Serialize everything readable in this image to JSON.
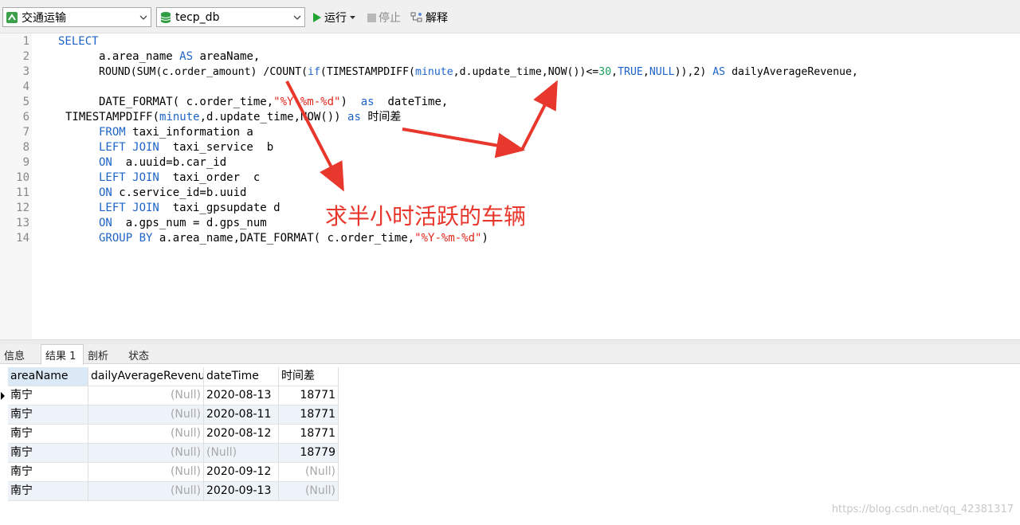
{
  "toolbar": {
    "connection": "交通运输",
    "database": "tecp_db",
    "run_label": "运行",
    "stop_label": "停止",
    "explain_label": "解释"
  },
  "editor": {
    "line_numbers": [
      "1",
      "2",
      "3",
      "4",
      "5",
      "6",
      "7",
      "8",
      "9",
      "10",
      "11",
      "12",
      "13",
      "14"
    ],
    "annotation": "求半小时活跃的车辆",
    "code": {
      "l1_kw": "SELECT",
      "l2_a": "a.area_name ",
      "l2_kw": "AS",
      "l2_b": " areaName,",
      "l3_a": "ROUND(SUM(c.order_amount) /COUNT(",
      "l3_if": "if",
      "l3_b": "(TIMESTAMPDIFF(",
      "l3_min": "minute",
      "l3_c": ",d.update_time,NOW())<=",
      "l3_30": "30",
      "l3_d": ",",
      "l3_true": "TRUE",
      "l3_e": ",",
      "l3_null": "NULL",
      "l3_f": ")),2) ",
      "l3_as": "AS",
      "l3_g": " dailyAverageRevenue,",
      "l5_a": "DATE_FORMAT( c.order_time,",
      "l5_str": "\"%Y-%m-%d\"",
      "l5_b": ")  ",
      "l5_as": "as",
      "l5_c": "  dateTime,",
      "l6_a": "TIMESTAMPDIFF(",
      "l6_min": "minute",
      "l6_b": ",d.update_time,NOW()) ",
      "l6_as": "as",
      "l6_c": " 时间差",
      "l7_kw": "FROM",
      "l7_b": " taxi_information a",
      "l8_kw": "LEFT JOIN",
      "l8_b": "  taxi_service  b",
      "l9_kw": "ON",
      "l9_b": "  a.uuid=b.car_id",
      "l10_kw": "LEFT JOIN",
      "l10_b": "  taxi_order  c",
      "l11_kw": "ON",
      "l11_b": " c.service_id=b.uuid",
      "l12_kw": "LEFT JOIN",
      "l12_b": "  taxi_gpsupdate d",
      "l13_kw": "ON",
      "l13_b": "  a.gps_num = d.gps_num",
      "l14_kw": "GROUP BY",
      "l14_b": " a.area_name,DATE_FORMAT( c.order_time,",
      "l14_str": "\"%Y-%m-%d\"",
      "l14_c": ")"
    }
  },
  "tabs": [
    "信息",
    "结果 1",
    "剖析",
    "状态"
  ],
  "result": {
    "columns": [
      "areaName",
      "dailyAverageRevenue",
      "dateTime",
      "时间差"
    ],
    "rows": [
      [
        "南宁",
        "(Null)",
        "2020-08-13",
        "18771"
      ],
      [
        "南宁",
        "(Null)",
        "2020-08-11",
        "18771"
      ],
      [
        "南宁",
        "(Null)",
        "2020-08-12",
        "18771"
      ],
      [
        "南宁",
        "(Null)",
        "(Null)",
        "18779"
      ],
      [
        "南宁",
        "(Null)",
        "2020-09-12",
        "(Null)"
      ],
      [
        "南宁",
        "(Null)",
        "2020-09-13",
        "(Null)"
      ]
    ]
  },
  "watermark": "https://blog.csdn.net/qq_42381317",
  "colors": {
    "keyword": "#1e64c8",
    "string": "#e0281e",
    "number": "#1aa05a",
    "annotation": "#e8372c"
  }
}
